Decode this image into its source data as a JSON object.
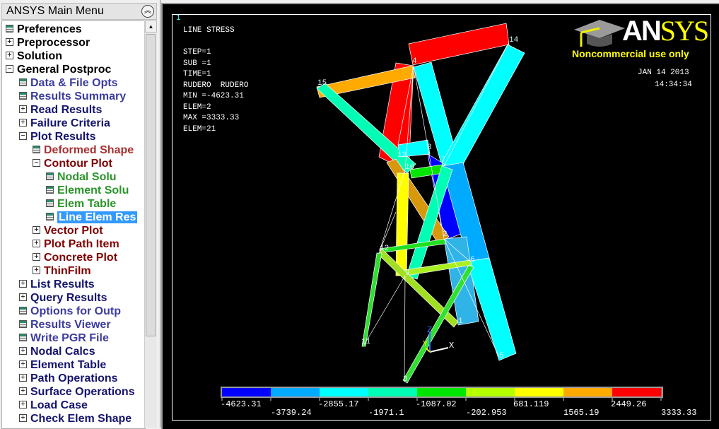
{
  "menu": {
    "title": "ANSYS Main Menu",
    "items": [
      {
        "label": "Preferences",
        "level": 0,
        "icon": "doc",
        "color": "#000000"
      },
      {
        "label": "Preprocessor",
        "level": 0,
        "icon": "plus",
        "color": "#000000"
      },
      {
        "label": "Solution",
        "level": 0,
        "icon": "plus",
        "color": "#000000"
      },
      {
        "label": "General Postproc",
        "level": 0,
        "icon": "minus",
        "color": "#000000"
      },
      {
        "label": "Data & File Opts",
        "level": 1,
        "icon": "doc",
        "color": "#3c3ca0"
      },
      {
        "label": "Results Summary",
        "level": 1,
        "icon": "doc",
        "color": "#3c3ca0"
      },
      {
        "label": "Read Results",
        "level": 1,
        "icon": "plus",
        "color": "#14146e"
      },
      {
        "label": "Failure Criteria",
        "level": 1,
        "icon": "plus",
        "color": "#14146e"
      },
      {
        "label": "Plot Results",
        "level": 1,
        "icon": "minus",
        "color": "#14146e"
      },
      {
        "label": "Deformed Shape",
        "level": 2,
        "icon": "doc",
        "color": "#a83232"
      },
      {
        "label": "Contour Plot",
        "level": 2,
        "icon": "minus",
        "color": "#800000"
      },
      {
        "label": "Nodal Solu",
        "level": 3,
        "icon": "doc",
        "color": "#2a962a"
      },
      {
        "label": "Element Solu",
        "level": 3,
        "icon": "doc",
        "color": "#2a962a"
      },
      {
        "label": "Elem Table",
        "level": 3,
        "icon": "doc",
        "color": "#2a962a"
      },
      {
        "label": "Line Elem Res",
        "level": 3,
        "icon": "doc",
        "color": "#2a962a",
        "selected": true
      },
      {
        "label": "Vector Plot",
        "level": 2,
        "icon": "plus",
        "color": "#800000"
      },
      {
        "label": "Plot Path Item",
        "level": 2,
        "icon": "plus",
        "color": "#800000"
      },
      {
        "label": "Concrete Plot",
        "level": 2,
        "icon": "plus",
        "color": "#800000"
      },
      {
        "label": "ThinFilm",
        "level": 2,
        "icon": "plus",
        "color": "#800000"
      },
      {
        "label": "List Results",
        "level": 1,
        "icon": "plus",
        "color": "#14146e"
      },
      {
        "label": "Query Results",
        "level": 1,
        "icon": "plus",
        "color": "#14146e"
      },
      {
        "label": "Options for Outp",
        "level": 1,
        "icon": "doc",
        "color": "#3c3ca0"
      },
      {
        "label": "Results Viewer",
        "level": 1,
        "icon": "doc",
        "color": "#3c3ca0"
      },
      {
        "label": "Write PGR File",
        "level": 1,
        "icon": "doc",
        "color": "#3c3ca0"
      },
      {
        "label": "Nodal Calcs",
        "level": 1,
        "icon": "plus",
        "color": "#14146e"
      },
      {
        "label": "Element Table",
        "level": 1,
        "icon": "plus",
        "color": "#14146e"
      },
      {
        "label": "Path Operations",
        "level": 1,
        "icon": "plus",
        "color": "#14146e"
      },
      {
        "label": "Surface Operations",
        "level": 1,
        "icon": "plus",
        "color": "#14146e"
      },
      {
        "label": "Load Case",
        "level": 1,
        "icon": "plus",
        "color": "#14146e"
      },
      {
        "label": "Check Elem Shape",
        "level": 1,
        "icon": "plus",
        "color": "#14146e"
      }
    ]
  },
  "graphics": {
    "window_number": "1",
    "info_lines": [
      "LINE STRESS",
      "",
      "STEP=1",
      "SUB =1",
      "TIME=1",
      "RUDERO  RUDERO",
      "MIN =-4623.31",
      "ELEM=2",
      "MAX =3333.33",
      "ELEM=21"
    ],
    "date": "JAN 14 2013",
    "time": "14:34:34",
    "logo": {
      "brand": "ANSYS",
      "tagline": "Noncommercial use only",
      "brand_color": "#ffff00"
    },
    "node_labels": [
      "14",
      "4",
      "15",
      "13",
      "3",
      "10",
      "7",
      "2",
      "12",
      "6",
      "9",
      "1",
      "11",
      "5",
      "8"
    ],
    "triad": {
      "x": "X",
      "y": "Y",
      "z": "Z"
    },
    "legend": {
      "colors": [
        "#0000ff",
        "#00aaff",
        "#00ffff",
        "#00ffb4",
        "#00e600",
        "#b4ff00",
        "#ffff00",
        "#ffaa00",
        "#ff0000"
      ],
      "labels_top": [
        "-4623.31",
        "-2855.17",
        "-1087.02",
        "681.119",
        "2449.26"
      ],
      "labels_bottom": [
        "-3739.24",
        "-1971.1",
        "-202.953",
        "1565.19",
        "3333.33"
      ]
    }
  }
}
